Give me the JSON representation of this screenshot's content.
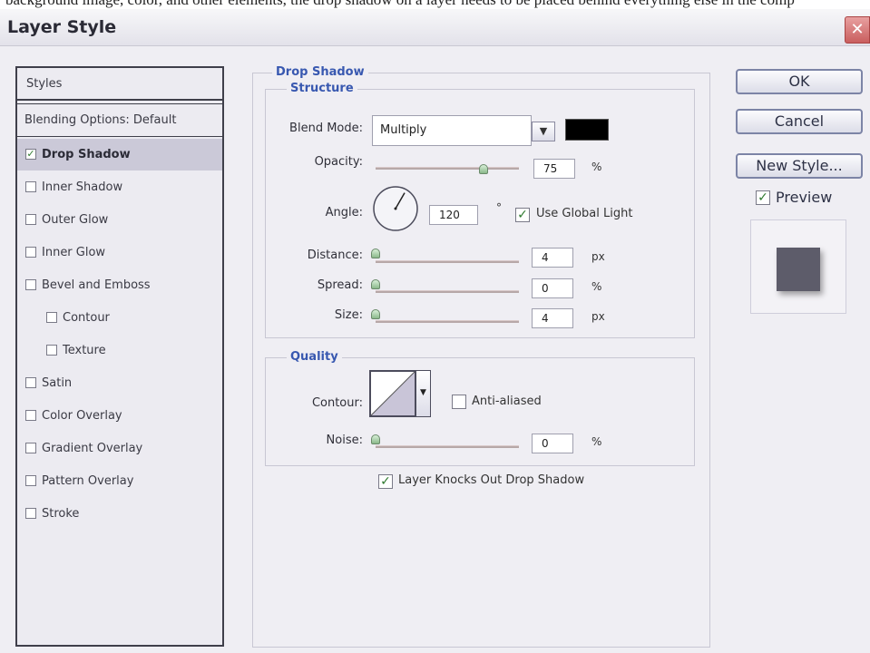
{
  "page_text_top": "background image, color, and other elements, the drop shadow on a layer needs to be placed behind everything else in the comp",
  "dialog": {
    "title": "Layer Style",
    "close_glyph": "✕"
  },
  "styles_panel": {
    "header": "Styles",
    "blending": "Blending Options: Default",
    "items": [
      {
        "label": "Drop Shadow",
        "checked": true,
        "selected": true
      },
      {
        "label": "Inner Shadow",
        "checked": false
      },
      {
        "label": "Outer Glow",
        "checked": false
      },
      {
        "label": "Inner Glow",
        "checked": false
      },
      {
        "label": "Bevel and Emboss",
        "checked": false
      },
      {
        "label": "Contour",
        "checked": false,
        "sub": true
      },
      {
        "label": "Texture",
        "checked": false,
        "sub": true
      },
      {
        "label": "Satin",
        "checked": false
      },
      {
        "label": "Color Overlay",
        "checked": false
      },
      {
        "label": "Gradient Overlay",
        "checked": false
      },
      {
        "label": "Pattern Overlay",
        "checked": false
      },
      {
        "label": "Stroke",
        "checked": false
      }
    ]
  },
  "drop_shadow": {
    "group_title": "Drop Shadow",
    "structure": {
      "title": "Structure",
      "blend_mode_label": "Blend Mode:",
      "blend_mode_value": "Multiply",
      "shadow_color": "#000000",
      "opacity_label": "Opacity:",
      "opacity_value": "75",
      "opacity_unit": "%",
      "opacity_level": 0.75,
      "angle_label": "Angle:",
      "angle_value": "120",
      "angle_unit": "°",
      "global_light_label": "Use Global Light",
      "global_light_checked": true,
      "distance_label": "Distance:",
      "distance_value": "4",
      "distance_unit": "px",
      "spread_label": "Spread:",
      "spread_value": "0",
      "spread_unit": "%",
      "size_label": "Size:",
      "size_value": "4",
      "size_unit": "px"
    },
    "quality": {
      "title": "Quality",
      "contour_label": "Contour:",
      "anti_aliased_label": "Anti-aliased",
      "anti_aliased_checked": false,
      "noise_label": "Noise:",
      "noise_value": "0",
      "noise_unit": "%"
    },
    "knockout_label": "Layer Knocks Out Drop Shadow",
    "knockout_checked": true
  },
  "buttons": {
    "ok": "OK",
    "cancel": "Cancel",
    "new_style": "New Style...",
    "preview_label": "Preview",
    "preview_checked": true,
    "preview_swatch_color": "#5d5c6a"
  }
}
